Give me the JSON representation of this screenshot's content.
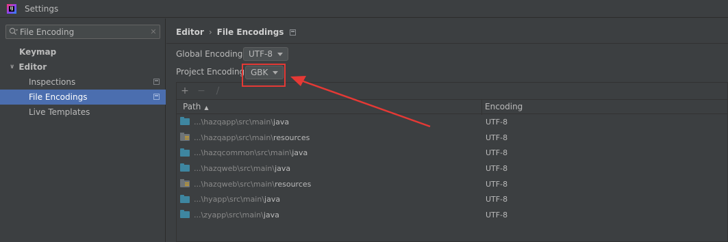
{
  "window": {
    "title": "Settings"
  },
  "search": {
    "value": "File Encoding",
    "clear_glyph": "✕"
  },
  "sidebar": {
    "items": [
      {
        "label": "Keymap"
      },
      {
        "label": "Editor",
        "expand_glyph": "∨"
      },
      {
        "label": "Inspections"
      },
      {
        "label": "File Encodings",
        "selected": true
      },
      {
        "label": "Live Templates"
      }
    ]
  },
  "breadcrumb": {
    "parent": "Editor",
    "separator": "›",
    "current": "File Encodings"
  },
  "global_encoding": {
    "label": "Global Encoding:",
    "value": "UTF-8"
  },
  "project_encoding": {
    "label": "Project Encoding:",
    "value": "GBK"
  },
  "toolbar": {
    "add_glyph": "+",
    "remove_glyph": "−",
    "edit_glyph": "∕"
  },
  "table": {
    "columns": {
      "path": "Path",
      "sort_glyph": "▲",
      "encoding": "Encoding"
    },
    "rows": [
      {
        "prefix": "...\\hazqapp\\src\\main\\",
        "last": "java",
        "type": "src-folder-icon",
        "encoding": "UTF-8"
      },
      {
        "prefix": "...\\hazqapp\\src\\main\\",
        "last": "resources",
        "type": "resources-folder-icon",
        "encoding": "UTF-8"
      },
      {
        "prefix": "...\\hazqcommon\\src\\main\\",
        "last": "java",
        "type": "src-folder-icon",
        "encoding": "UTF-8"
      },
      {
        "prefix": "...\\hazqweb\\src\\main\\",
        "last": "java",
        "type": "src-folder-icon",
        "encoding": "UTF-8"
      },
      {
        "prefix": "...\\hazqweb\\src\\main\\",
        "last": "resources",
        "type": "resources-folder-icon",
        "encoding": "UTF-8"
      },
      {
        "prefix": "...\\hyapp\\src\\main\\",
        "last": "java",
        "type": "src-folder-icon",
        "encoding": "UTF-8"
      },
      {
        "prefix": "...\\zyapp\\src\\main\\",
        "last": "java",
        "type": "src-folder-icon",
        "encoding": "UTF-8"
      }
    ]
  },
  "annotation": {
    "color": "#e53935"
  }
}
